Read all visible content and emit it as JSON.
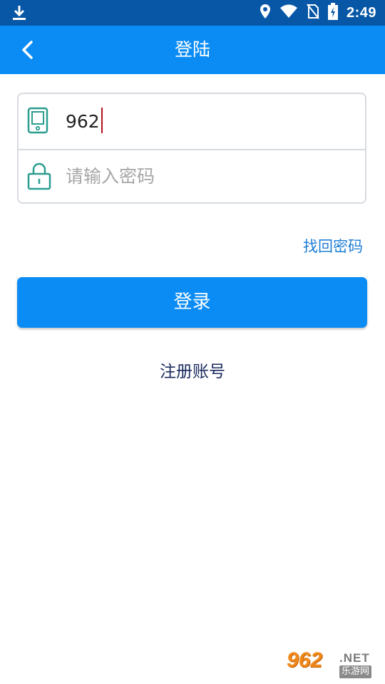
{
  "status_bar": {
    "time": "2:49",
    "icons": [
      "download-icon",
      "location-icon",
      "wifi-icon",
      "no-sim-icon",
      "battery-charging-icon"
    ]
  },
  "app_bar": {
    "title": "登陆",
    "back_icon": "chevron-left-icon"
  },
  "form": {
    "phone_value": "962",
    "phone_icon": "phone-icon",
    "password_placeholder": "请输入密码",
    "password_icon": "lock-icon"
  },
  "links": {
    "forgot_password": "找回密码",
    "register": "注册账号"
  },
  "login_button": {
    "label": "登录"
  },
  "watermark": {
    "brand": "962",
    "suffix": ".NET",
    "site_name": "乐游网"
  },
  "colors": {
    "status_bar": "#0757a6",
    "primary": "#0b8cf5",
    "link": "#1e7fd4",
    "register_text": "#1a2a5e",
    "icon_teal": "#2a9d8f",
    "caret": "#b3121a"
  }
}
